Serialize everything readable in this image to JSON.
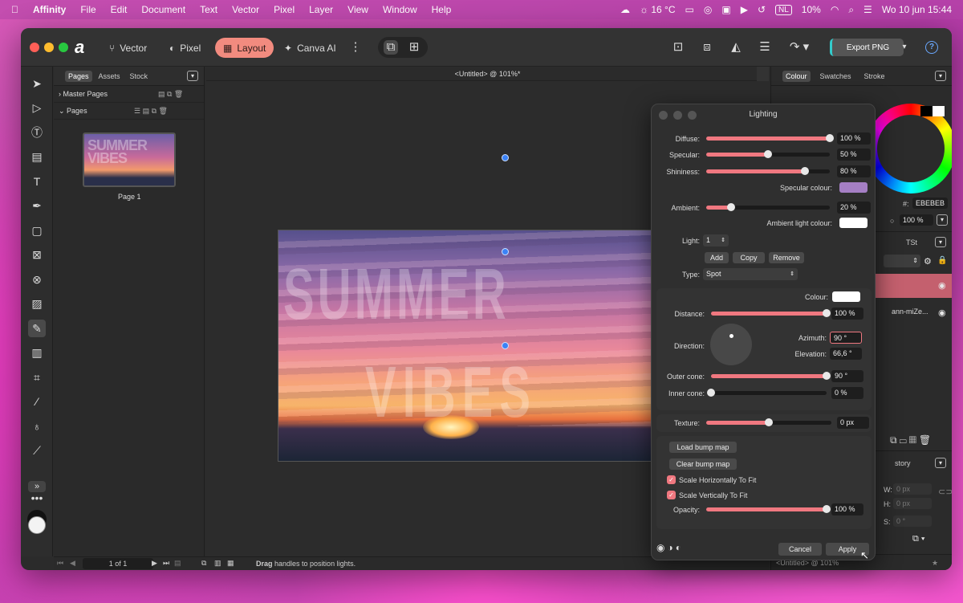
{
  "menubar": {
    "app": "Affinity",
    "items": [
      "File",
      "Edit",
      "Document",
      "Text",
      "Vector",
      "Pixel",
      "Layer",
      "View",
      "Window",
      "Help"
    ],
    "weather": "16 °C",
    "input_lang": "NL",
    "battery": "10%",
    "clock": "Wo 10 jun  15:44"
  },
  "toolbar": {
    "personas": [
      "Vector",
      "Pixel",
      "Layout",
      "Canva AI"
    ],
    "active_persona": "Layout",
    "export_label": "Export PNG"
  },
  "pages_panel": {
    "tabs": [
      "Pages",
      "Assets",
      "Stock"
    ],
    "master_pages": "Master Pages",
    "pages": "Pages",
    "thumb_text": "SUMMER VIBES",
    "page_label": "Page 1"
  },
  "canvas": {
    "doc_title": "<Untitled> @ 101%*",
    "word1": "SUMMER",
    "word2": "VIBES",
    "page_counter": "1 of 1",
    "status_bold": "Drag",
    "status_text": " handles to position lights."
  },
  "right_panel": {
    "tabs": [
      "Colour",
      "Swatches",
      "Stroke"
    ],
    "hex_label": "#:",
    "hex_value": "EBEBEB",
    "opacity": "100 %",
    "layers_tab": "TSt",
    "layer_name": "ann-miZe...",
    "history_tab": "story",
    "w_label": "W:",
    "w_value": "0 px",
    "h_label": "H:",
    "h_value": "0 px",
    "s_label": "S:",
    "s_value": "0 °",
    "footer": "<Untitled> @ 101%"
  },
  "lighting": {
    "title": "Lighting",
    "diffuse": {
      "label": "Diffuse:",
      "value": "100 %",
      "level": 1.0
    },
    "specular": {
      "label": "Specular:",
      "value": "50 %",
      "level": 0.5
    },
    "shininess": {
      "label": "Shininess:",
      "value": "80 %",
      "level": 0.8
    },
    "specular_colour_label": "Specular colour:",
    "specular_colour": "#a57fc4",
    "ambient": {
      "label": "Ambient:",
      "value": "20 %",
      "level": 0.2
    },
    "ambient_colour_label": "Ambient light colour:",
    "ambient_colour": "#ffffff",
    "light_label": "Light:",
    "light_value": "1",
    "add": "Add",
    "copy": "Copy",
    "remove": "Remove",
    "type_label": "Type:",
    "type_value": "Spot",
    "colour_label": "Colour:",
    "colour": "#ffffff",
    "distance": {
      "label": "Distance:",
      "value": "100 %",
      "level": 1.0
    },
    "direction_label": "Direction:",
    "azimuth_label": "Azimuth:",
    "azimuth_value": "90 °",
    "elevation_label": "Elevation:",
    "elevation_value": "66,6 °",
    "outer_cone": {
      "label": "Outer cone:",
      "value": "90 °",
      "level": 1.0
    },
    "inner_cone": {
      "label": "Inner cone:",
      "value": "0 %",
      "level": 0.0
    },
    "texture": {
      "label": "Texture:",
      "value": "0 px",
      "level": 0.5
    },
    "load_bump": "Load bump map",
    "clear_bump": "Clear bump map",
    "scale_h": "Scale Horizontally To Fit",
    "scale_v": "Scale Vertically To Fit",
    "opacity": {
      "label": "Opacity:",
      "value": "100 %",
      "level": 1.0
    },
    "cancel": "Cancel",
    "apply": "Apply"
  },
  "colors": {
    "accent": "#f07880",
    "persona_active": "#f28b7f"
  }
}
